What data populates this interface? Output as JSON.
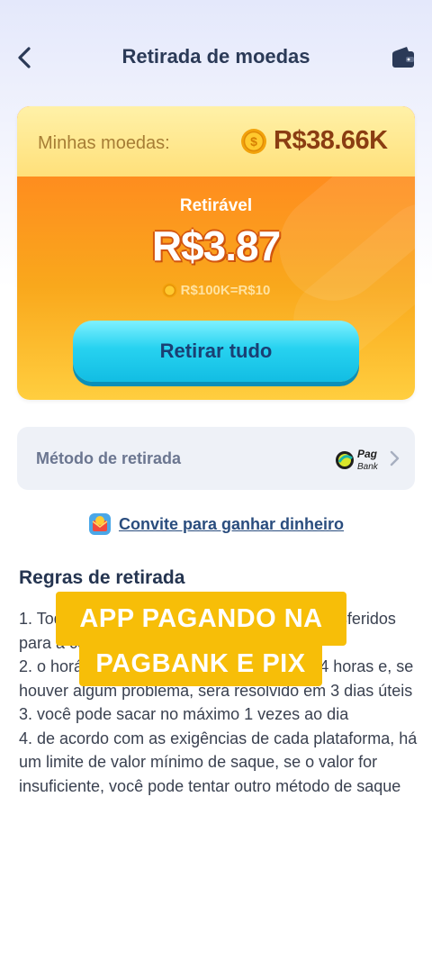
{
  "header": {
    "title": "Retirada de moedas",
    "back_icon": "chevron-left-icon",
    "wallet_icon": "wallet-icon"
  },
  "card": {
    "coins_label": "Minhas moedas:",
    "coins_value": "R$38.66K",
    "withdrawable_label": "Retirável",
    "withdrawable_value": "R$3.87",
    "rate": "R$100K=R$10",
    "withdraw_button": "Retirar tudo"
  },
  "method": {
    "label": "Método de retirada",
    "provider_logo_text_1": "Pag",
    "provider_logo_text_2": "Bank"
  },
  "invite": {
    "text": "Convite para ganhar dinheiro"
  },
  "rules": {
    "title": "Regras de retirada",
    "lines": [
      "1. Todos os saldos ficarão congelados e transferidos para a conta designada",
      "2. o horário de chegada é de 1 minuto a 24 horas e, se houver algum problema, será resolvido em 3 dias úteis",
      "3. você pode sacar no máximo 1 vezes ao dia",
      "4. de acordo com as exigências de cada plataforma, há um limite de valor mínimo de saque, se o valor for insuficiente, você pode tentar outro método de saque"
    ]
  },
  "overlay": {
    "line1": "APP PAGANDO NA",
    "line2": "PAGBANK E PIX"
  },
  "colors": {
    "card_orange": "#ff8b1f",
    "button_cyan": "#27d2f0",
    "banner_yellow": "#f7be08"
  }
}
